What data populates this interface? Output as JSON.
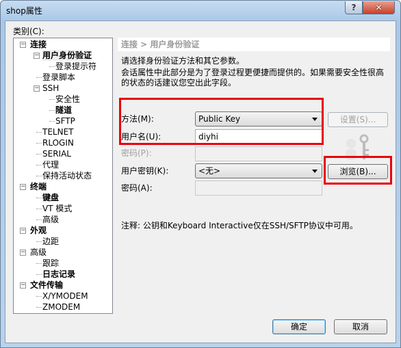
{
  "window": {
    "title": "shop属性",
    "help": "?",
    "close": "✕"
  },
  "category_label": "类别(C):",
  "tree": [
    {
      "label": "连接",
      "level": 0,
      "bold": true,
      "expanded": true
    },
    {
      "label": "用户身份验证",
      "level": 1,
      "bold": true,
      "expanded": true,
      "selected": true
    },
    {
      "label": "登录提示符",
      "level": 2
    },
    {
      "label": "登录脚本",
      "level": 1
    },
    {
      "label": "SSH",
      "level": 1,
      "expanded": true
    },
    {
      "label": "安全性",
      "level": 2
    },
    {
      "label": "隧道",
      "level": 2,
      "bold": true
    },
    {
      "label": "SFTP",
      "level": 2
    },
    {
      "label": "TELNET",
      "level": 1
    },
    {
      "label": "RLOGIN",
      "level": 1
    },
    {
      "label": "SERIAL",
      "level": 1
    },
    {
      "label": "代理",
      "level": 1
    },
    {
      "label": "保持活动状态",
      "level": 1
    },
    {
      "label": "终端",
      "level": 0,
      "bold": true,
      "expanded": true
    },
    {
      "label": "键盘",
      "level": 1,
      "bold": true
    },
    {
      "label": "VT 模式",
      "level": 1
    },
    {
      "label": "高级",
      "level": 1
    },
    {
      "label": "外观",
      "level": 0,
      "bold": true,
      "expanded": true
    },
    {
      "label": "边距",
      "level": 1
    },
    {
      "label": "高级",
      "level": 0,
      "expanded": true
    },
    {
      "label": "跟踪",
      "level": 1
    },
    {
      "label": "日志记录",
      "level": 1,
      "bold": true
    },
    {
      "label": "文件传输",
      "level": 0,
      "bold": true,
      "expanded": true
    },
    {
      "label": "X/YMODEM",
      "level": 1
    },
    {
      "label": "ZMODEM",
      "level": 1
    }
  ],
  "panel": {
    "breadcrumb": "连接 > 用户身份验证",
    "intro1": "请选择身份验证方法和其它参数。",
    "intro2": "会话属性中此部分是为了登录过程更便捷而提供的。如果需要安全性很高",
    "intro3": "的状态的话建议您空出此字段。",
    "method_label": "方法(M):",
    "method_value": "Public Key",
    "username_label": "用户名(U):",
    "username_value": "diyhi",
    "password_label": "密码(P):",
    "password_value": "",
    "userkey_label": "用户密钥(K):",
    "userkey_value": "<无>",
    "passphrase_label": "密码(A):",
    "passphrase_value": "",
    "settings_button": "设置(S)...",
    "browse_button": "浏览(B)...",
    "note": "注释: 公钥和Keyboard Interactive仅在SSH/SFTP协议中可用。"
  },
  "footer": {
    "ok": "确定",
    "cancel": "取消"
  },
  "colors": {
    "highlight": "#e8000b"
  }
}
